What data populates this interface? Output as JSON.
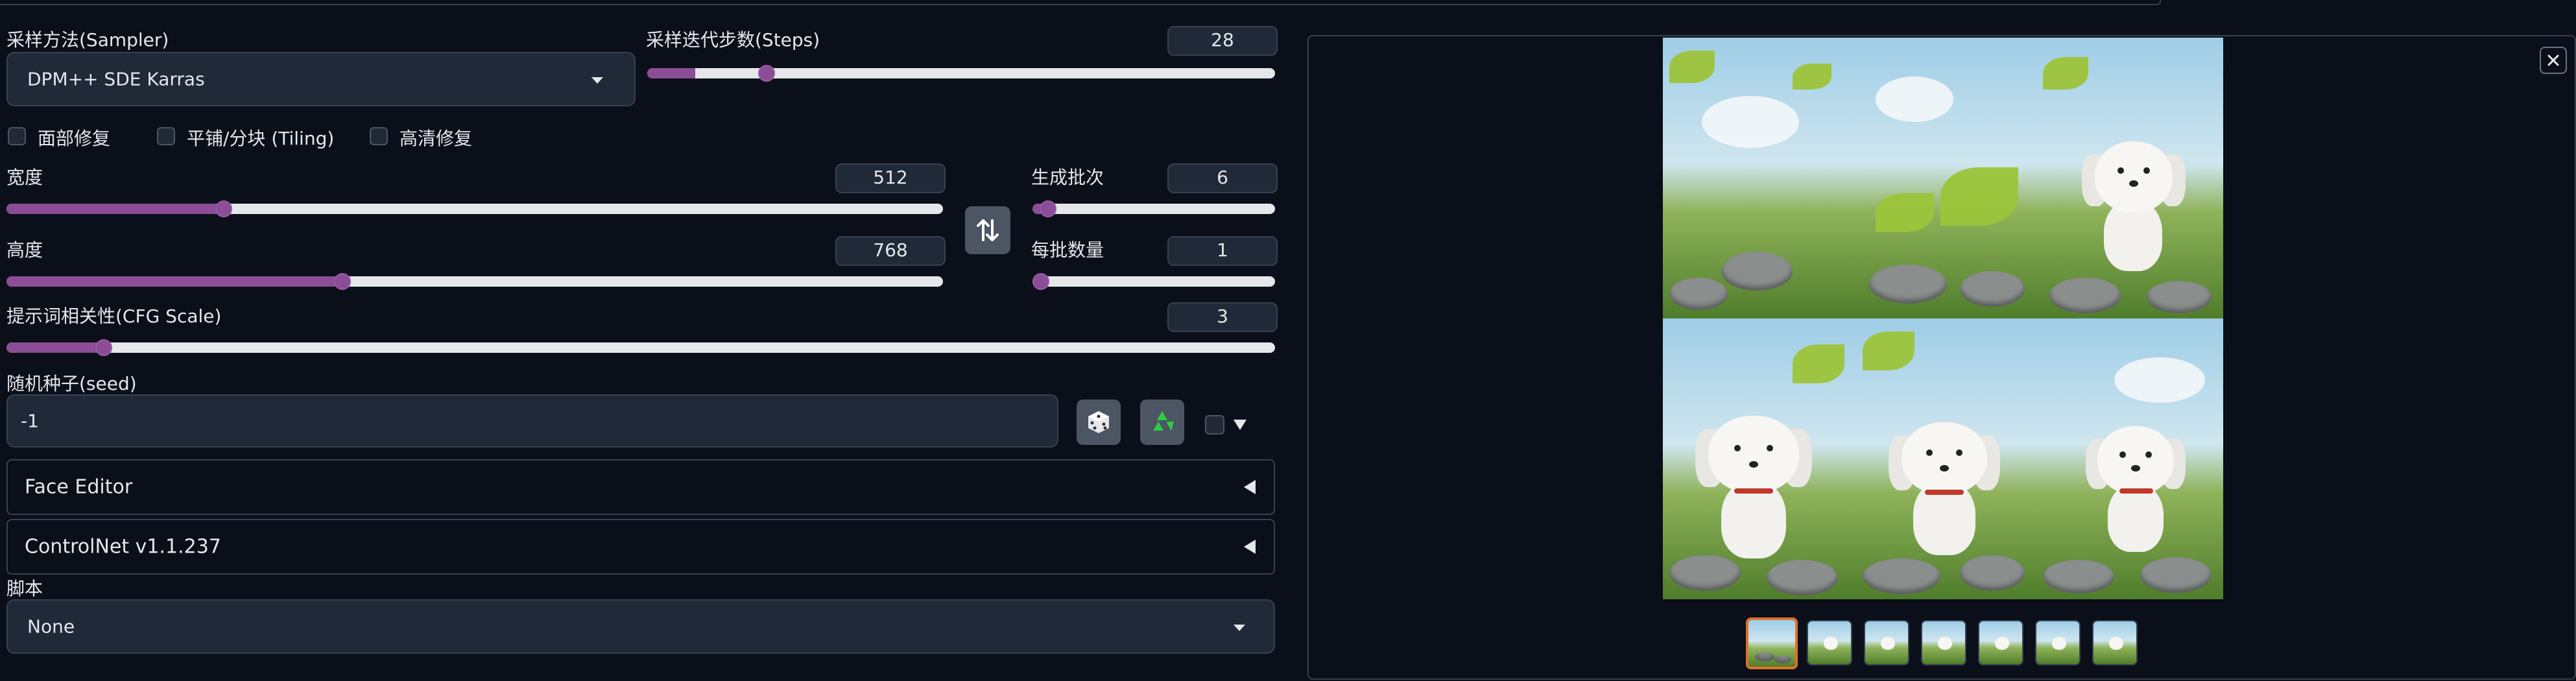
{
  "sampler": {
    "label": "采样方法(Sampler)",
    "value": "DPM++ SDE Karras"
  },
  "steps": {
    "label": "采样迭代步数(Steps)",
    "value": "28",
    "fraction": 0.098
  },
  "checkboxes": [
    {
      "label": "面部修复",
      "checked": false
    },
    {
      "label": "平铺/分块 (Tiling)",
      "checked": false
    },
    {
      "label": "高清修复",
      "checked": false
    }
  ],
  "width": {
    "label": "宽度",
    "value": "512",
    "fraction": 0.229
  },
  "height": {
    "label": "高度",
    "value": "768",
    "fraction": 0.358
  },
  "batch_count": {
    "label": "生成批次",
    "value": "6",
    "fraction": 0.04
  },
  "batch_size": {
    "label": "每批数量",
    "value": "1",
    "fraction": 0.0
  },
  "cfg": {
    "label": "提示词相关性(CFG Scale)",
    "value": "3",
    "fraction": 0.072
  },
  "seed": {
    "label": "随机种子(seed)",
    "value": "-1"
  },
  "accordions": {
    "face_editor": "Face Editor",
    "controlnet": "ControlNet v1.1.237"
  },
  "script": {
    "label": "脚本",
    "value": "None"
  },
  "gallery": {
    "thumbnail_count": 7,
    "selected_index": 0
  },
  "icons": {
    "swap": "swap-dimensions-icon",
    "dice": "dice-icon",
    "recycle": "recycle-icon",
    "close": "close-icon"
  },
  "colors": {
    "slider_fill": "#8b4d96",
    "selected_thumb_border": "#e0702a",
    "background": "#0b0f19"
  }
}
